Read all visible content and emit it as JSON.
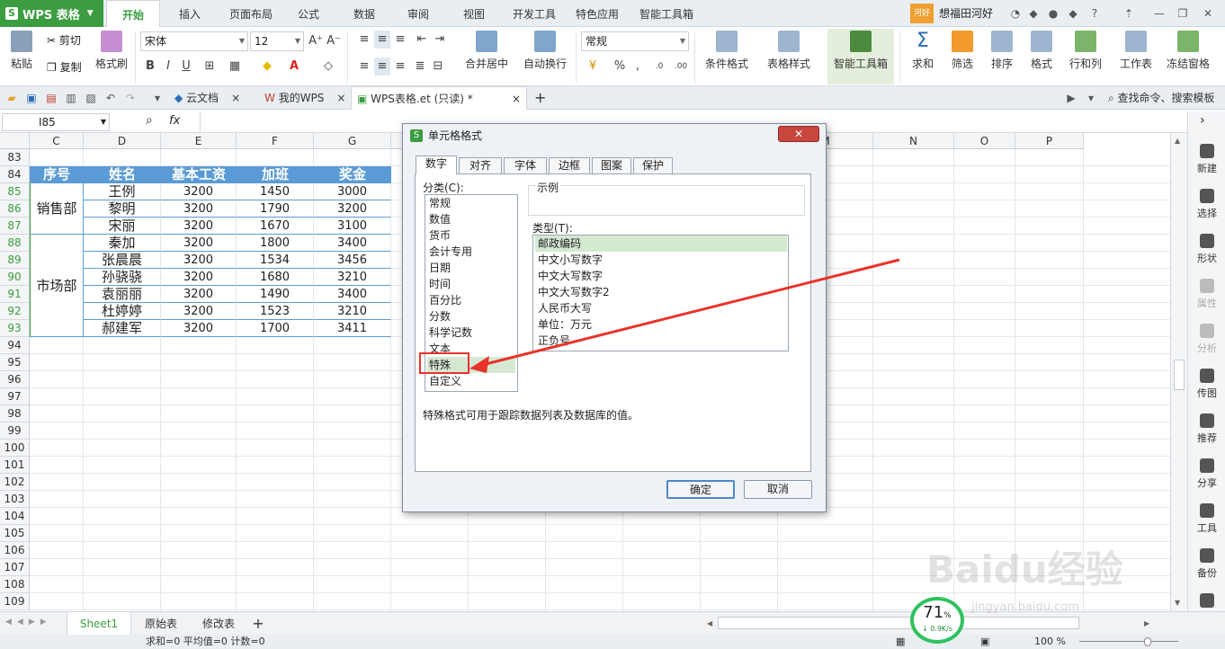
{
  "app": {
    "name": "WPS 表格"
  },
  "menu": {
    "tabs": [
      "开始",
      "插入",
      "页面布局",
      "公式",
      "数据",
      "审阅",
      "视图",
      "开发工具",
      "特色应用",
      "智能工具箱"
    ]
  },
  "user": {
    "badge": "河好",
    "name": "想福田河好"
  },
  "ribbon": {
    "cut": "剪切",
    "paste": "粘贴",
    "copy": "复制",
    "format_painter": "格式刷",
    "font": "宋体",
    "font_size": "12",
    "merge": "合并居中",
    "wrap": "自动换行",
    "number_format": "常规",
    "cond_format": "条件格式",
    "table_style": "表格样式",
    "smart_toolbox": "智能工具箱",
    "sum": "求和",
    "filter": "筛选",
    "sort": "排序",
    "format": "格式",
    "rowcol": "行和列",
    "worksheet": "工作表",
    "freeze": "冻结窗格",
    "bold": "B",
    "italic": "I",
    "underline": "U",
    "percent": "%"
  },
  "doctabs": {
    "cloud": "云文档",
    "mywps": "我的WPS",
    "file": "WPS表格.et (只读) *",
    "search": "查找命令、搜索模板"
  },
  "formula": {
    "cell_ref": "I85",
    "fx": "fx"
  },
  "grid": {
    "columns": [
      "C",
      "D",
      "E",
      "F",
      "G",
      "H",
      "I",
      "J",
      "K",
      "L",
      "M",
      "N",
      "O",
      "P"
    ],
    "rows": [
      "83",
      "84",
      "85",
      "86",
      "87",
      "88",
      "89",
      "90",
      "91",
      "92",
      "93",
      "94",
      "95",
      "96",
      "97",
      "98",
      "99",
      "100",
      "101",
      "102",
      "103",
      "104",
      "105",
      "106",
      "107",
      "108",
      "109"
    ],
    "headers": [
      "序号",
      "姓名",
      "基本工资",
      "加班",
      "奖金"
    ],
    "dept1": "销售部",
    "dept2": "市场部",
    "data": [
      [
        "王例",
        "3200",
        "1450",
        "3000"
      ],
      [
        "黎明",
        "3200",
        "1790",
        "3200"
      ],
      [
        "宋丽",
        "3200",
        "1670",
        "3100"
      ],
      [
        "秦加",
        "3200",
        "1800",
        "3400"
      ],
      [
        "张晨晨",
        "3200",
        "1534",
        "3456"
      ],
      [
        "孙骁骁",
        "3200",
        "1680",
        "3210"
      ],
      [
        "袁丽丽",
        "3200",
        "1490",
        "3400"
      ],
      [
        "杜婷婷",
        "3200",
        "1523",
        "3210"
      ],
      [
        "郝建军",
        "3200",
        "1700",
        "3411"
      ]
    ]
  },
  "right_panel": [
    "新建",
    "选择",
    "形状",
    "属性",
    "分析",
    "传图",
    "推荐",
    "分享",
    "工具",
    "备份",
    "帮助"
  ],
  "sheets": [
    "Sheet1",
    "原始表",
    "修改表"
  ],
  "status": {
    "text": "求和=0  平均值=0  计数=0",
    "zoom": "100 %",
    "speed_pct": "71",
    "speed_unit": "%",
    "speed_rate": "0.9K/s"
  },
  "dialog": {
    "title": "单元格格式",
    "tabs": [
      "数字",
      "对齐",
      "字体",
      "边框",
      "图案",
      "保护"
    ],
    "category_label": "分类(C):",
    "categories": [
      "常规",
      "数值",
      "货币",
      "会计专用",
      "日期",
      "时间",
      "百分比",
      "分数",
      "科学记数",
      "文本",
      "特殊",
      "自定义"
    ],
    "example_label": "示例",
    "type_label": "类型(T):",
    "types": [
      "邮政编码",
      "中文小写数字",
      "中文大写数字",
      "中文大写数字2",
      "人民币大写",
      "单位：万元",
      "正负号"
    ],
    "description": "特殊格式可用于跟踪数据列表及数据库的值。",
    "ok": "确定",
    "cancel": "取消",
    "close": "✕"
  },
  "watermark": "Baidu经验",
  "watermark_sub": "jingyan.baidu.com",
  "colors": {
    "brand": "#3b9d3f",
    "header_fill": "#5b9bd5",
    "selection": "#d5e9d2",
    "arrow": "#e8332a"
  }
}
